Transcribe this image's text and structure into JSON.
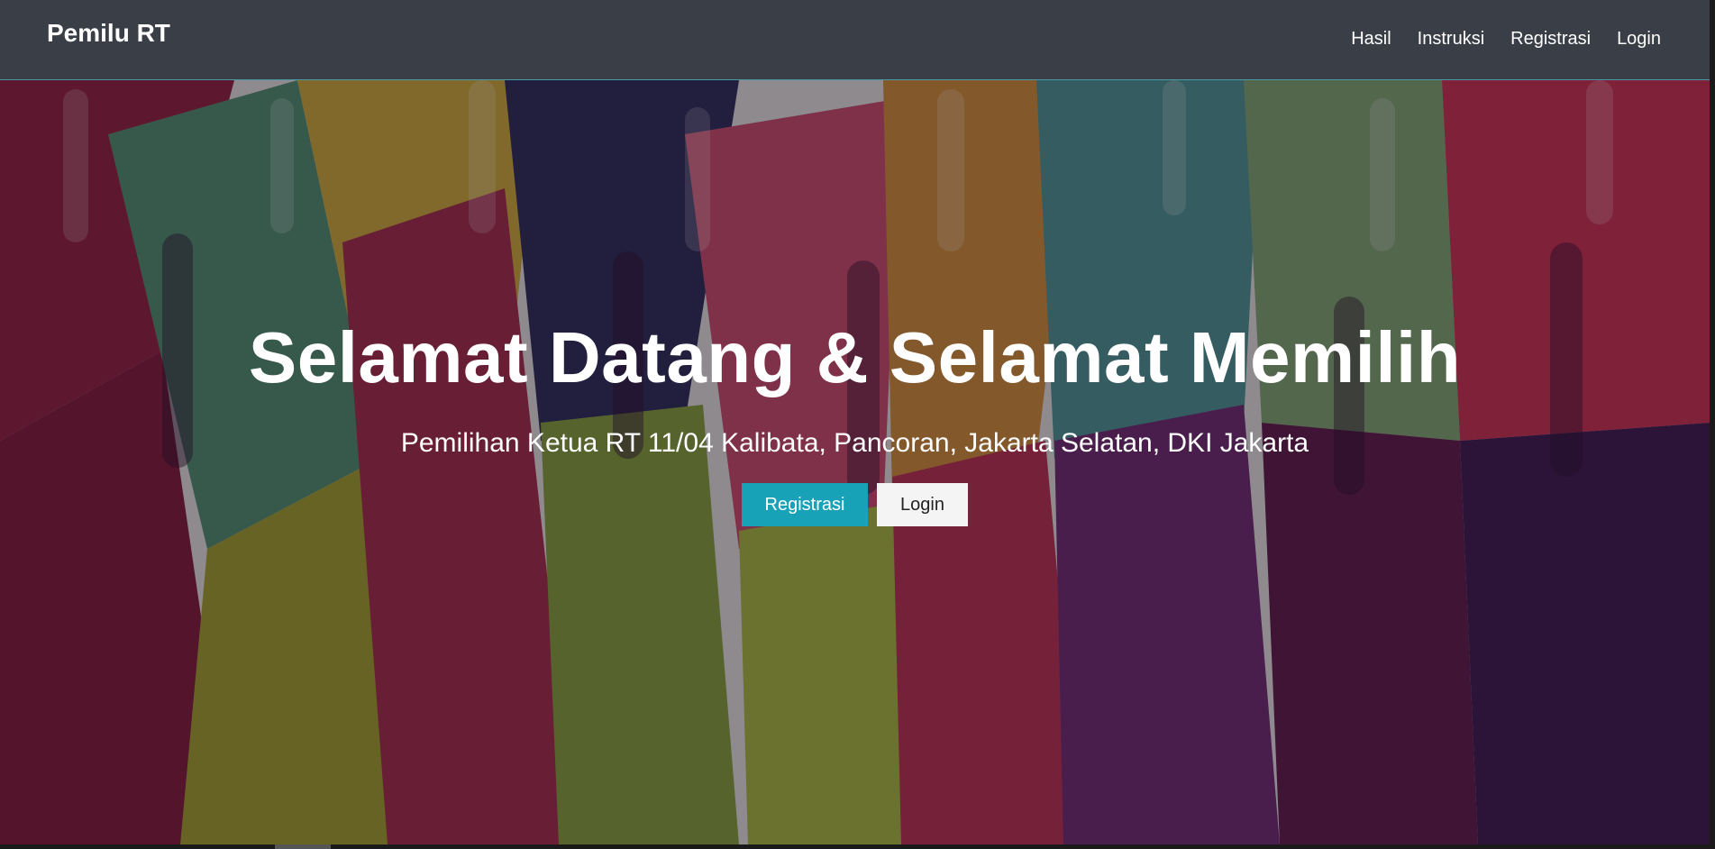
{
  "navbar": {
    "brand": "Pemilu RT",
    "links": [
      {
        "label": "Hasil"
      },
      {
        "label": "Instruksi"
      },
      {
        "label": "Registrasi"
      },
      {
        "label": "Login"
      }
    ]
  },
  "hero": {
    "title": "Selamat Datang & Selamat Memilih",
    "subtitle": "Pemilihan Ketua RT 11/04 Kalibata, Pancoran, Jakarta Selatan, DKI Jakarta",
    "register_button": "Registrasi",
    "login_button": "Login",
    "background_image": "raised-hands-illustration"
  },
  "colors": {
    "navbar_bg": "#3a3f47",
    "primary": "#17a2b8",
    "secondary_button_bg": "#f4f4f4"
  }
}
